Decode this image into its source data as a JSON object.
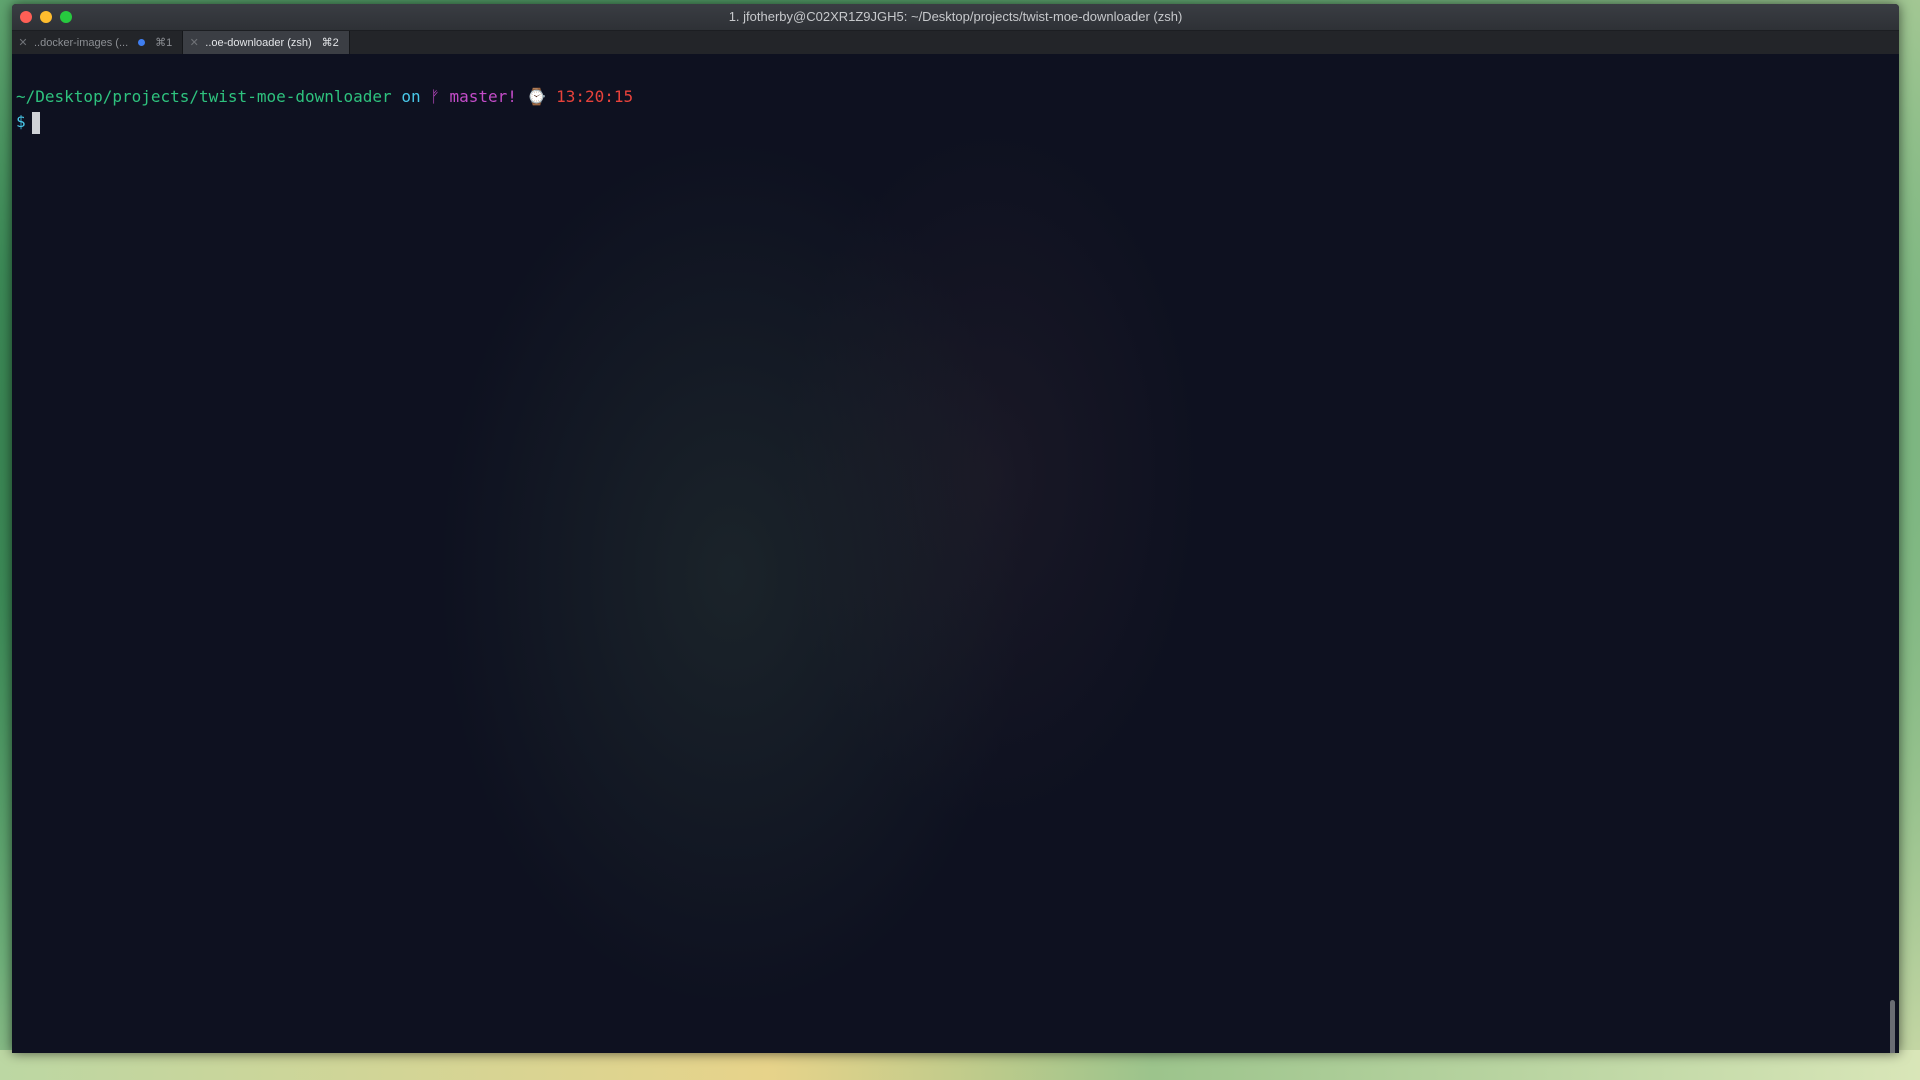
{
  "window": {
    "title": "1. jfotherby@C02XR1Z9JGH5: ~/Desktop/projects/twist-moe-downloader (zsh)"
  },
  "tabs": [
    {
      "label": "..docker-images (...",
      "shortcut": "⌘1",
      "active": false,
      "has_activity_dot": true
    },
    {
      "label": "..oe-downloader (zsh)",
      "shortcut": "⌘2",
      "active": true,
      "has_activity_dot": false
    }
  ],
  "prompt": {
    "path": "~/Desktop/projects/twist-moe-downloader",
    "on_word": "on",
    "branch_icon": "git-branch-icon",
    "branch": "master!",
    "clock_icon": "clock-icon",
    "time": "13:20:15",
    "symbol": "$"
  },
  "colors": {
    "path": "#2ec27e",
    "on": "#48c7e8",
    "branch": "#c34cc8",
    "time": "#e8423b",
    "terminal_bg": "#0e1120"
  }
}
